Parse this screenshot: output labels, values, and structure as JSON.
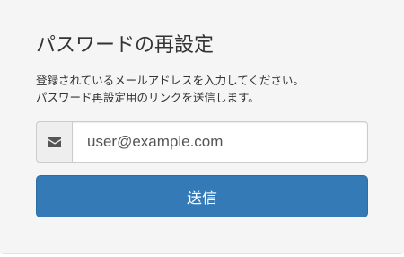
{
  "form": {
    "title": "パスワードの再設定",
    "description_line1": "登録されているメールアドレスを入力してください。",
    "description_line2": "パスワード再設定用のリンクを送信します。",
    "email_addon_icon": "envelope-icon",
    "email_value": "user@example.com",
    "submit_label": "送信"
  },
  "colors": {
    "panel_background": "#f5f5f5",
    "addon_background": "#eeeeee",
    "icon": "#555555",
    "primary_button": "#337ab7",
    "primary_button_text": "#ffffff",
    "text": "#333333"
  }
}
